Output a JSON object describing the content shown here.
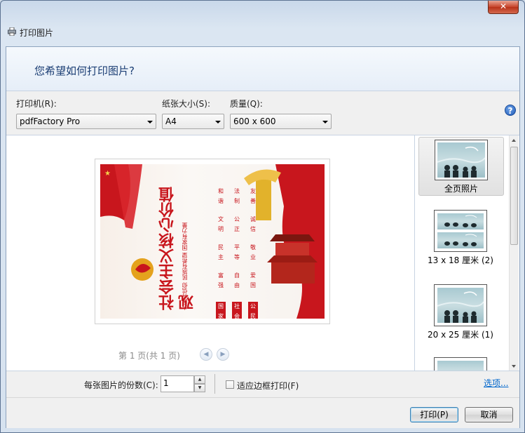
{
  "window": {
    "title": "打印图片",
    "close_glyph": "✕"
  },
  "header": {
    "question": "您希望如何打印图片?"
  },
  "settings": {
    "printer_label": "打印机(R):",
    "printer_value": "pdfFactory Pro",
    "paper_label": "纸张大小(S):",
    "paper_value": "A4",
    "quality_label": "质量(Q):",
    "quality_value": "600 x 600",
    "help_glyph": "?"
  },
  "preview": {
    "page_info": "第 1 页(共 1 页)",
    "poster": {
      "headline": "社会主义核心价值观",
      "sub1": "人民有信仰 民族有希望 国家有力量",
      "col_nation": [
        "国家",
        "富强",
        "民主",
        "文明",
        "和谐"
      ],
      "col_society": [
        "社会",
        "自由",
        "平等",
        "公正",
        "法制"
      ],
      "col_citizen": [
        "公民",
        "爱国",
        "敬业",
        "诚信",
        "友善"
      ]
    }
  },
  "layouts": [
    {
      "label": "全页照片",
      "selected": true
    },
    {
      "label": "13 x 18 厘米 (2)",
      "selected": false
    },
    {
      "label": "20 x 25 厘米 (1)",
      "selected": false
    },
    {
      "label": "",
      "selected": false
    }
  ],
  "options": {
    "copies_label": "每张图片的份数(C):",
    "copies_value": "1",
    "fit_label": "适应边框打印(F)",
    "fit_checked": false,
    "options_link": "选项..."
  },
  "footer": {
    "print_label": "打印(P)",
    "cancel_label": "取消"
  },
  "colors": {
    "accent": "#1b3e74",
    "link": "#0066cc",
    "poster_red": "#c8161d"
  }
}
